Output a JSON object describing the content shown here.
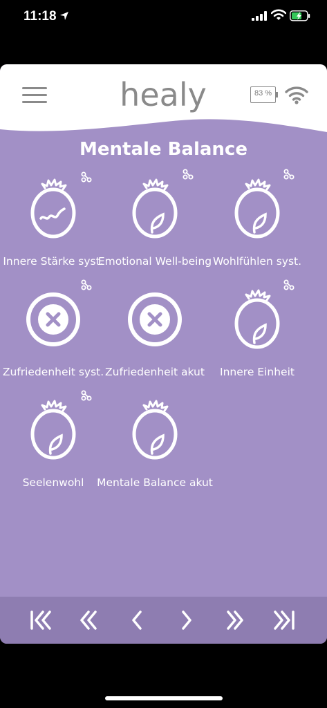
{
  "status_bar": {
    "time": "11:18",
    "icons": [
      "location-arrow-icon",
      "cellular-signal-icon",
      "wifi-icon",
      "battery-charging-icon"
    ]
  },
  "header": {
    "logo_text": "healy",
    "battery_percent": "83 %",
    "icons": [
      "menu-icon",
      "battery-icon",
      "wifi-icon"
    ]
  },
  "page": {
    "title": "Mentale Balance"
  },
  "programs": [
    {
      "label": "Innere Stärke syst.",
      "icon": "head-squiggle-icon",
      "linked": true
    },
    {
      "label": "Emotional Well-being",
      "icon": "head-leaf-icon",
      "linked": true
    },
    {
      "label": "Wohlfühlen syst.",
      "icon": "head-leaf-icon",
      "linked": true
    },
    {
      "label": "Zufriedenheit syst.",
      "icon": "blocked-x-icon",
      "linked": true
    },
    {
      "label": "Zufriedenheit akut",
      "icon": "blocked-x-icon",
      "linked": false
    },
    {
      "label": "Innere Einheit",
      "icon": "head-leaf-icon",
      "linked": true
    },
    {
      "label": "Seelenwohl",
      "icon": "head-leaf-icon",
      "linked": true
    },
    {
      "label": "Mentale Balance akut",
      "icon": "head-leaf-icon",
      "linked": false
    }
  ],
  "nav": {
    "buttons": [
      "first-page-icon",
      "fast-back-icon",
      "prev-icon",
      "next-icon",
      "fast-forward-icon",
      "last-page-icon"
    ]
  },
  "colors": {
    "background": "#a290c6",
    "nav_bar": "#8e7db1",
    "header": "#ffffff",
    "logo": "#8a8a8a",
    "battery_status": "#34c759"
  }
}
